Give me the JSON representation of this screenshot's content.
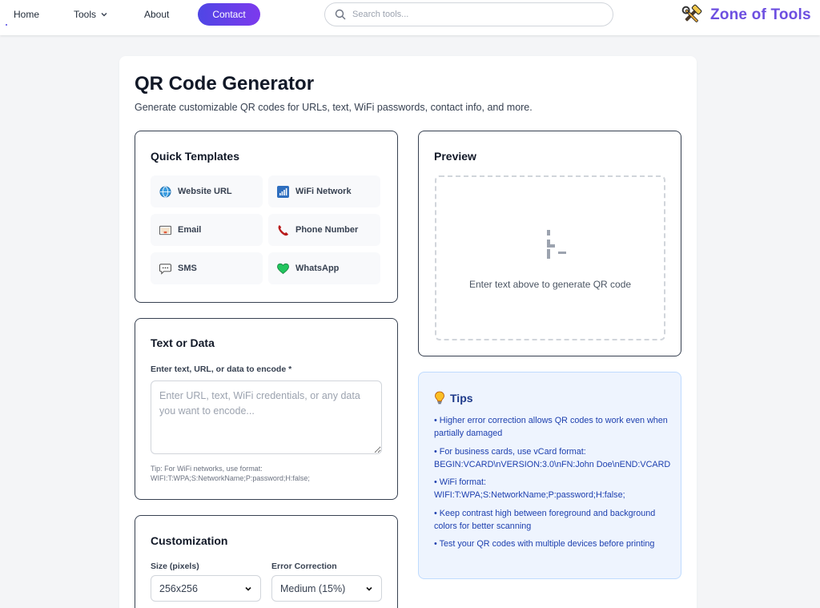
{
  "nav": {
    "home": "Home",
    "tools": "Tools",
    "about": "About",
    "contact": "Contact",
    "search_placeholder": "Search tools...",
    "logo_text": "Zone of Tools"
  },
  "page": {
    "title": "QR Code Generator",
    "subtitle": "Generate customizable QR codes for URLs, text, WiFi passwords, contact info, and more."
  },
  "templates": {
    "title": "Quick Templates",
    "items": [
      {
        "label": "Website URL",
        "icon": "globe-icon"
      },
      {
        "label": "WiFi Network",
        "icon": "signal-icon"
      },
      {
        "label": "Email",
        "icon": "envelope-icon"
      },
      {
        "label": "Phone Number",
        "icon": "phone-icon"
      },
      {
        "label": "SMS",
        "icon": "speech-bubble-icon"
      },
      {
        "label": "WhatsApp",
        "icon": "green-heart-icon"
      }
    ]
  },
  "text_data": {
    "title": "Text or Data",
    "label": "Enter text, URL, or data to encode *",
    "placeholder": "Enter URL, text, WiFi credentials, or any data you want to encode...",
    "value": "",
    "tip": "Tip: For WiFi networks, use format: WIFI:T:WPA;S:NetworkName;P:password;H:false;"
  },
  "customization": {
    "title": "Customization",
    "size_label": "Size (pixels)",
    "size_value": "256x256",
    "error_label": "Error Correction",
    "error_value": "Medium (15%)"
  },
  "preview": {
    "title": "Preview",
    "empty_text": "Enter text above to generate QR code"
  },
  "tips": {
    "title": "Tips",
    "items": [
      "• Higher error correction allows QR codes to work even when partially damaged",
      "• For business cards, use vCard format: BEGIN:VCARD\\nVERSION:3.0\\nFN:John Doe\\nEND:VCARD",
      "• WiFi format: WIFI:T:WPA;S:NetworkName;P:password;H:false;",
      "• Keep contrast high between foreground and background colors for better scanning",
      "• Test your QR codes with multiple devices before printing"
    ]
  },
  "colors": {
    "accent": "#6d4fe0",
    "contact_gradient_start": "#4f46e5",
    "contact_gradient_end": "#7c3aed",
    "tips_background": "#eef4fe",
    "tips_text": "#1e40af"
  }
}
